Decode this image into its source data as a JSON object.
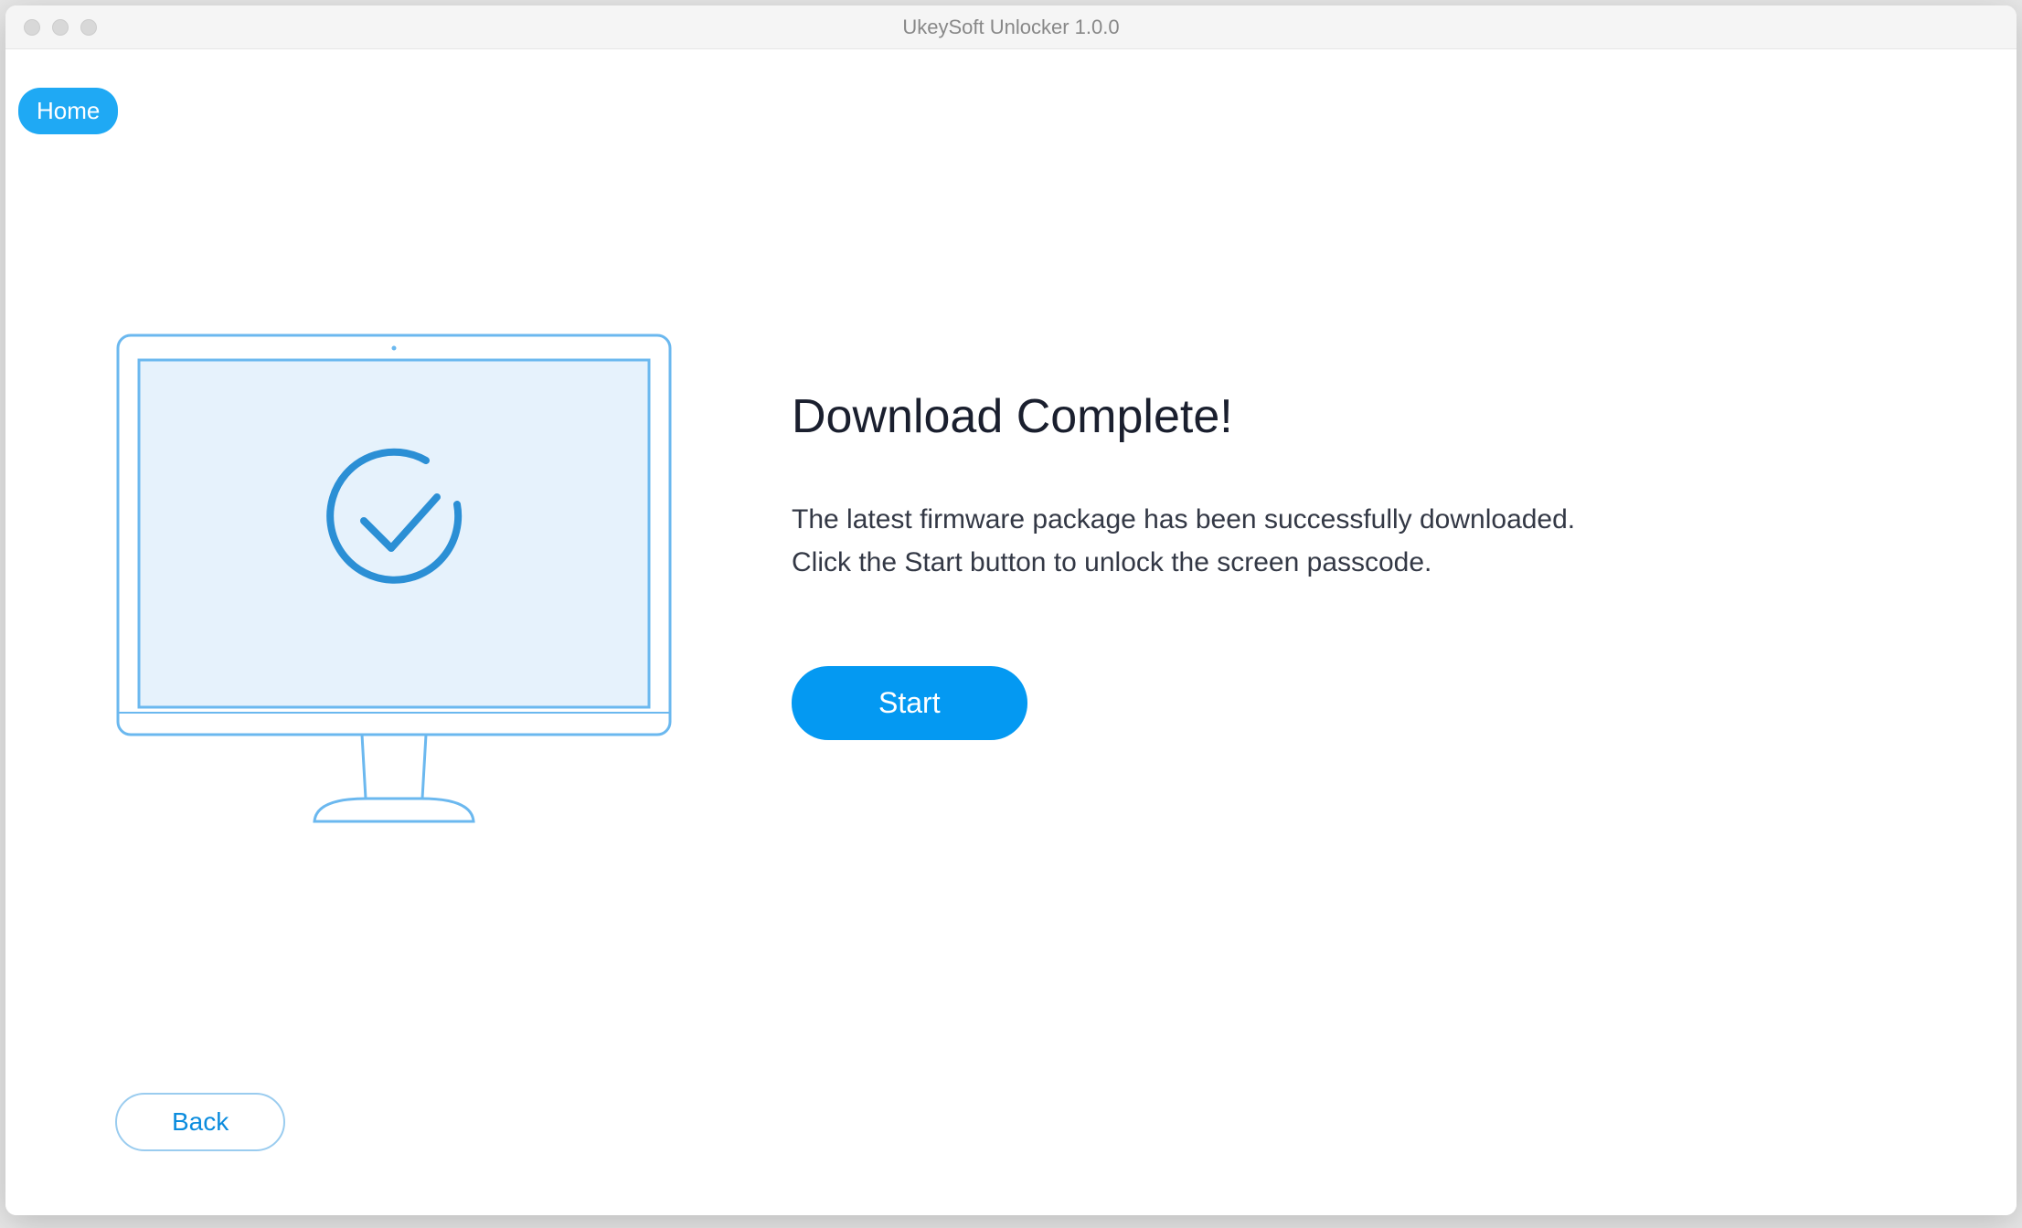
{
  "window": {
    "title": "UkeySoft Unlocker 1.0.0"
  },
  "nav": {
    "home_label": "Home"
  },
  "main": {
    "heading": "Download Complete!",
    "description_line1": "The latest firmware package has been successfully downloaded.",
    "description_line2": "Click the Start button to unlock the screen passcode.",
    "start_label": "Start"
  },
  "footer": {
    "back_label": "Back"
  }
}
